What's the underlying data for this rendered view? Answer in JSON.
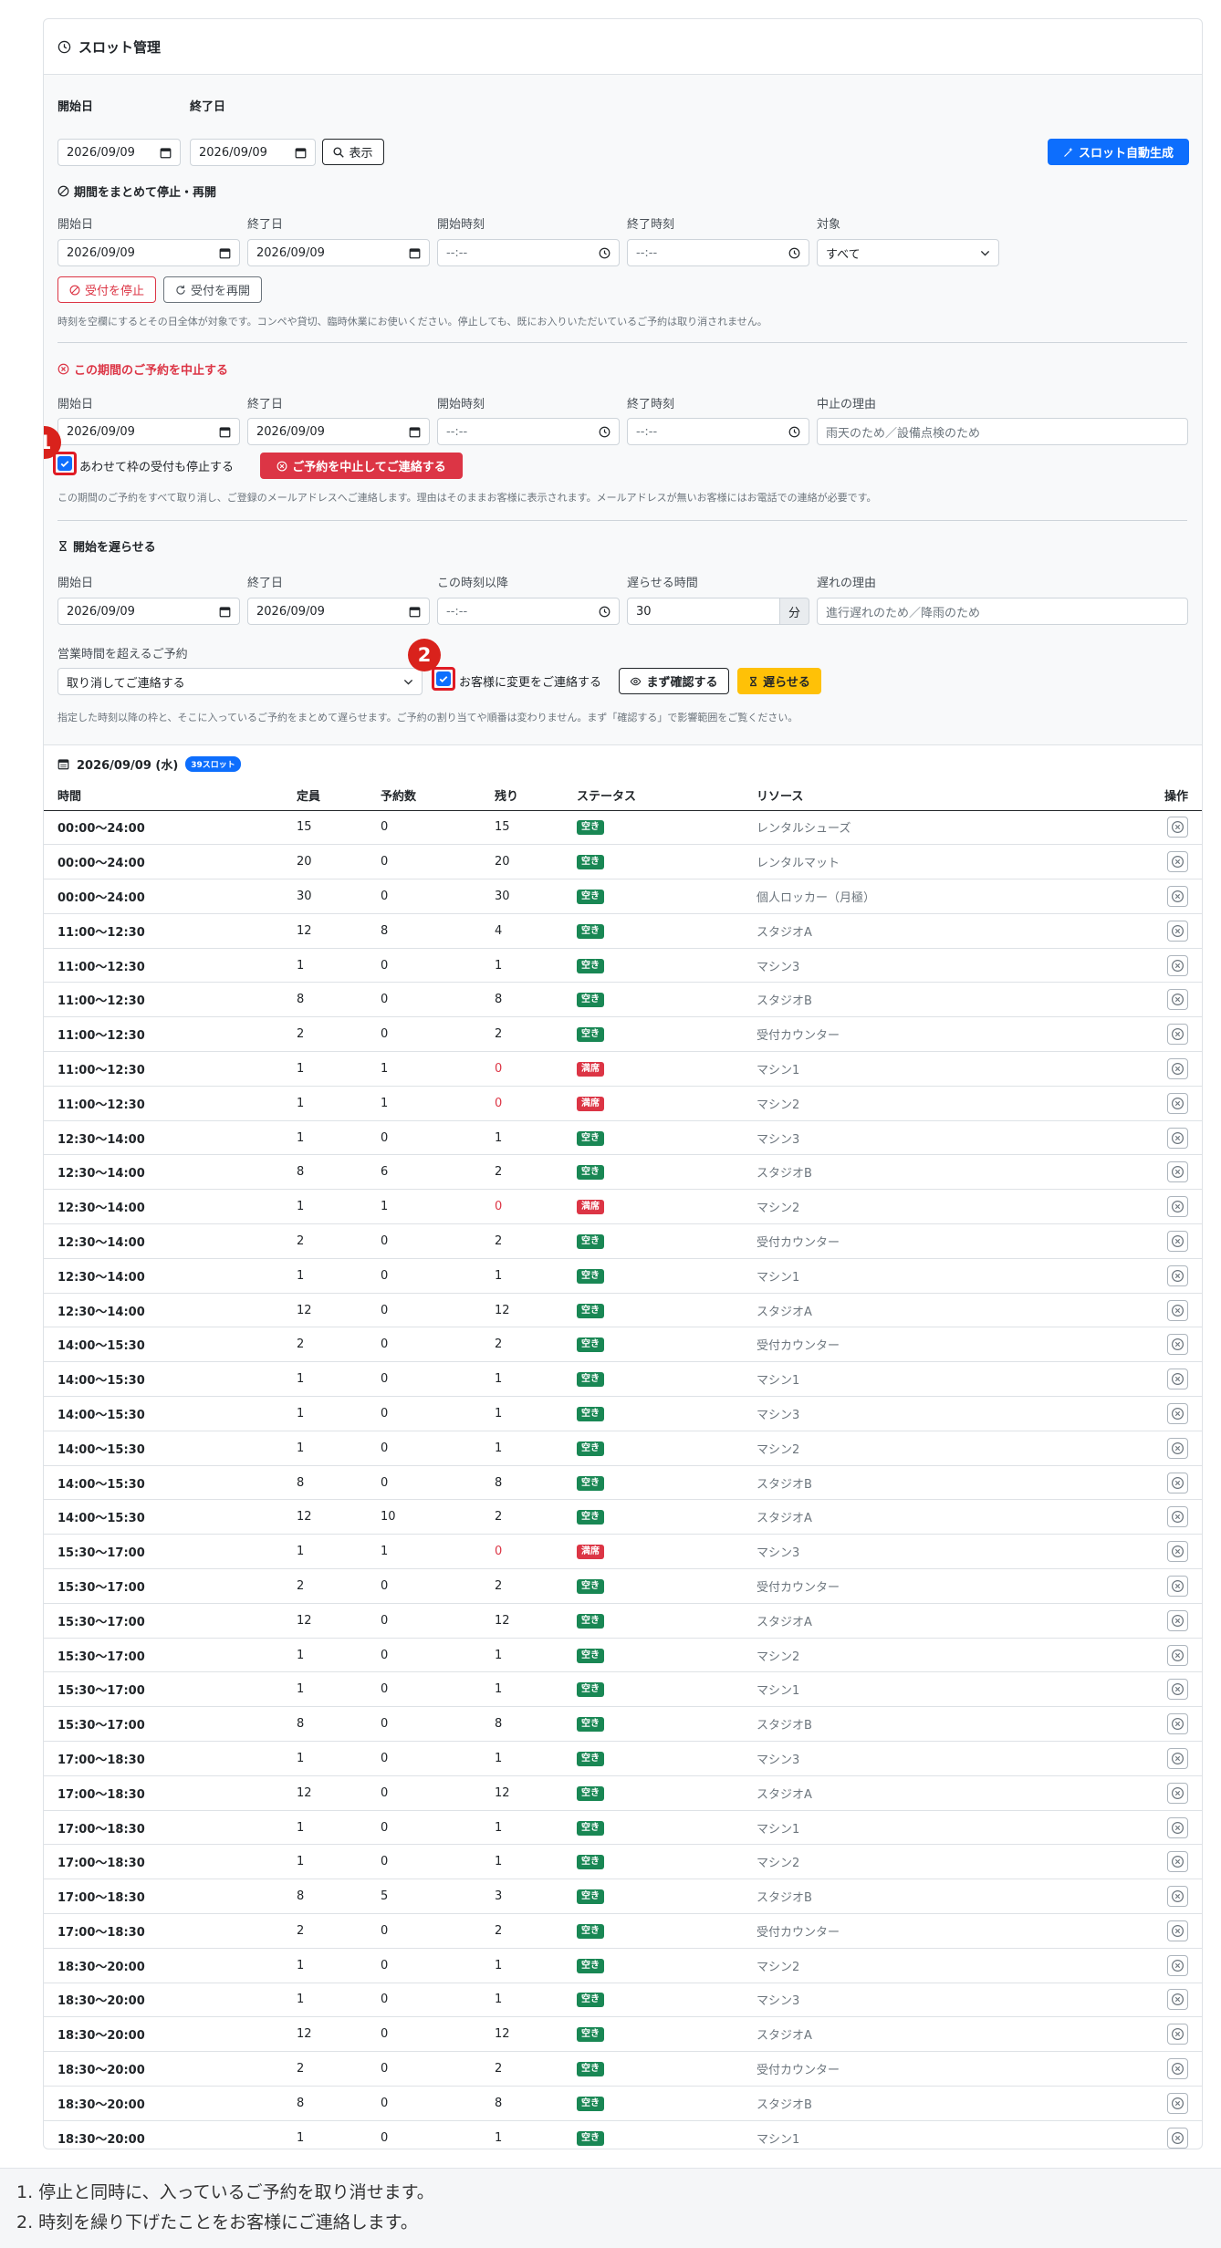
{
  "header": {
    "title": "スロット管理"
  },
  "range": {
    "start_label": "開始日",
    "end_label": "終了日",
    "start_value": "2026/09/09",
    "end_value": "2026/09/09",
    "show_button": "表示",
    "autogen_button": "スロット自動生成"
  },
  "pause": {
    "title": "期間をまとめて停止・再開",
    "start_label": "開始日",
    "end_label": "終了日",
    "stime_label": "開始時刻",
    "etime_label": "終了時刻",
    "target_label": "対象",
    "start_value": "2026/09/09",
    "end_value": "2026/09/09",
    "stime_value": "--:--",
    "etime_value": "--:--",
    "target_value": "すべて",
    "stop_button": "受付を停止",
    "resume_button": "受付を再開",
    "help": "時刻を空欄にするとその日全体が対象です。コンペや貸切、臨時休業にお使いください。停止しても、既にお入りいただいているご予約は取り消されません。"
  },
  "cancel": {
    "title": "この期間のご予約を中止する",
    "start_label": "開始日",
    "end_label": "終了日",
    "stime_label": "開始時刻",
    "etime_label": "終了時刻",
    "reason_label": "中止の理由",
    "start_value": "2026/09/09",
    "end_value": "2026/09/09",
    "stime_value": "--:--",
    "etime_value": "--:--",
    "reason_placeholder": "雨天のため／設備点検のため",
    "check_label": "あわせて枠の受付も停止する",
    "submit_button": "ご予約を中止してご連絡する",
    "help": "この期間のご予約をすべて取り消し、ご登録のメールアドレスへご連絡します。理由はそのままお客様に表示されます。メールアドレスが無いお客様にはお電話での連絡が必要です。"
  },
  "delay": {
    "title": "開始を遅らせる",
    "start_label": "開始日",
    "end_label": "終了日",
    "from_label": "この時刻以降",
    "shift_label": "遅らせる時間",
    "reason_label": "遅れの理由",
    "start_value": "2026/09/09",
    "end_value": "2026/09/09",
    "from_value": "--:--",
    "shift_value": "30",
    "shift_unit": "分",
    "reason_placeholder": "進行遅れのため／降雨のため",
    "overflow_label": "営業時間を超えるご予約",
    "overflow_value": "取り消してご連絡する",
    "notify_label": "お客様に変更をご連絡する",
    "check_button": "まず確認する",
    "submit_button": "遅らせる",
    "help": "指定した時刻以降の枠と、そこに入っているご予約をまとめて遅らせます。ご予約の割り当てや順番は変わりません。まず「確認する」で影響範囲をご覧ください。"
  },
  "markers": [
    "1",
    "2"
  ],
  "day": {
    "title": "2026/09/09 (水)",
    "badge": "39スロット"
  },
  "table": {
    "columns": [
      "時間",
      "定員",
      "予約数",
      "残り",
      "ステータス",
      "リソース",
      "操作"
    ],
    "rows": [
      [
        "00:00〜24:00",
        "15",
        "0",
        "15",
        "空き",
        "レンタルシューズ"
      ],
      [
        "00:00〜24:00",
        "20",
        "0",
        "20",
        "空き",
        "レンタルマット"
      ],
      [
        "00:00〜24:00",
        "30",
        "0",
        "30",
        "空き",
        "個人ロッカー（月極）"
      ],
      [
        "11:00〜12:30",
        "12",
        "8",
        "4",
        "空き",
        "スタジオA"
      ],
      [
        "11:00〜12:30",
        "1",
        "0",
        "1",
        "空き",
        "マシン3"
      ],
      [
        "11:00〜12:30",
        "8",
        "0",
        "8",
        "空き",
        "スタジオB"
      ],
      [
        "11:00〜12:30",
        "2",
        "0",
        "2",
        "空き",
        "受付カウンター"
      ],
      [
        "11:00〜12:30",
        "1",
        "1",
        "0",
        "満席",
        "マシン1"
      ],
      [
        "11:00〜12:30",
        "1",
        "1",
        "0",
        "満席",
        "マシン2"
      ],
      [
        "12:30〜14:00",
        "1",
        "0",
        "1",
        "空き",
        "マシン3"
      ],
      [
        "12:30〜14:00",
        "8",
        "6",
        "2",
        "空き",
        "スタジオB"
      ],
      [
        "12:30〜14:00",
        "1",
        "1",
        "0",
        "満席",
        "マシン2"
      ],
      [
        "12:30〜14:00",
        "2",
        "0",
        "2",
        "空き",
        "受付カウンター"
      ],
      [
        "12:30〜14:00",
        "1",
        "0",
        "1",
        "空き",
        "マシン1"
      ],
      [
        "12:30〜14:00",
        "12",
        "0",
        "12",
        "空き",
        "スタジオA"
      ],
      [
        "14:00〜15:30",
        "2",
        "0",
        "2",
        "空き",
        "受付カウンター"
      ],
      [
        "14:00〜15:30",
        "1",
        "0",
        "1",
        "空き",
        "マシン1"
      ],
      [
        "14:00〜15:30",
        "1",
        "0",
        "1",
        "空き",
        "マシン3"
      ],
      [
        "14:00〜15:30",
        "1",
        "0",
        "1",
        "空き",
        "マシン2"
      ],
      [
        "14:00〜15:30",
        "8",
        "0",
        "8",
        "空き",
        "スタジオB"
      ],
      [
        "14:00〜15:30",
        "12",
        "10",
        "2",
        "空き",
        "スタジオA"
      ],
      [
        "15:30〜17:00",
        "1",
        "1",
        "0",
        "満席",
        "マシン3"
      ],
      [
        "15:30〜17:00",
        "2",
        "0",
        "2",
        "空き",
        "受付カウンター"
      ],
      [
        "15:30〜17:00",
        "12",
        "0",
        "12",
        "空き",
        "スタジオA"
      ],
      [
        "15:30〜17:00",
        "1",
        "0",
        "1",
        "空き",
        "マシン2"
      ],
      [
        "15:30〜17:00",
        "1",
        "0",
        "1",
        "空き",
        "マシン1"
      ],
      [
        "15:30〜17:00",
        "8",
        "0",
        "8",
        "空き",
        "スタジオB"
      ],
      [
        "17:00〜18:30",
        "1",
        "0",
        "1",
        "空き",
        "マシン3"
      ],
      [
        "17:00〜18:30",
        "12",
        "0",
        "12",
        "空き",
        "スタジオA"
      ],
      [
        "17:00〜18:30",
        "1",
        "0",
        "1",
        "空き",
        "マシン1"
      ],
      [
        "17:00〜18:30",
        "1",
        "0",
        "1",
        "空き",
        "マシン2"
      ],
      [
        "17:00〜18:30",
        "8",
        "5",
        "3",
        "空き",
        "スタジオB"
      ],
      [
        "17:00〜18:30",
        "2",
        "0",
        "2",
        "空き",
        "受付カウンター"
      ],
      [
        "18:30〜20:00",
        "1",
        "0",
        "1",
        "空き",
        "マシン2"
      ],
      [
        "18:30〜20:00",
        "1",
        "0",
        "1",
        "空き",
        "マシン3"
      ],
      [
        "18:30〜20:00",
        "12",
        "0",
        "12",
        "空き",
        "スタジオA"
      ],
      [
        "18:30〜20:00",
        "2",
        "0",
        "2",
        "空き",
        "受付カウンター"
      ],
      [
        "18:30〜20:00",
        "8",
        "0",
        "8",
        "空き",
        "スタジオB"
      ],
      [
        "18:30〜20:00",
        "1",
        "0",
        "1",
        "空き",
        "マシン1"
      ]
    ]
  },
  "footnotes": [
    "1. 停止と同時に、入っているご予約を取り消せます。",
    "2. 時刻を繰り下げたことをお客様にご連絡します。"
  ]
}
